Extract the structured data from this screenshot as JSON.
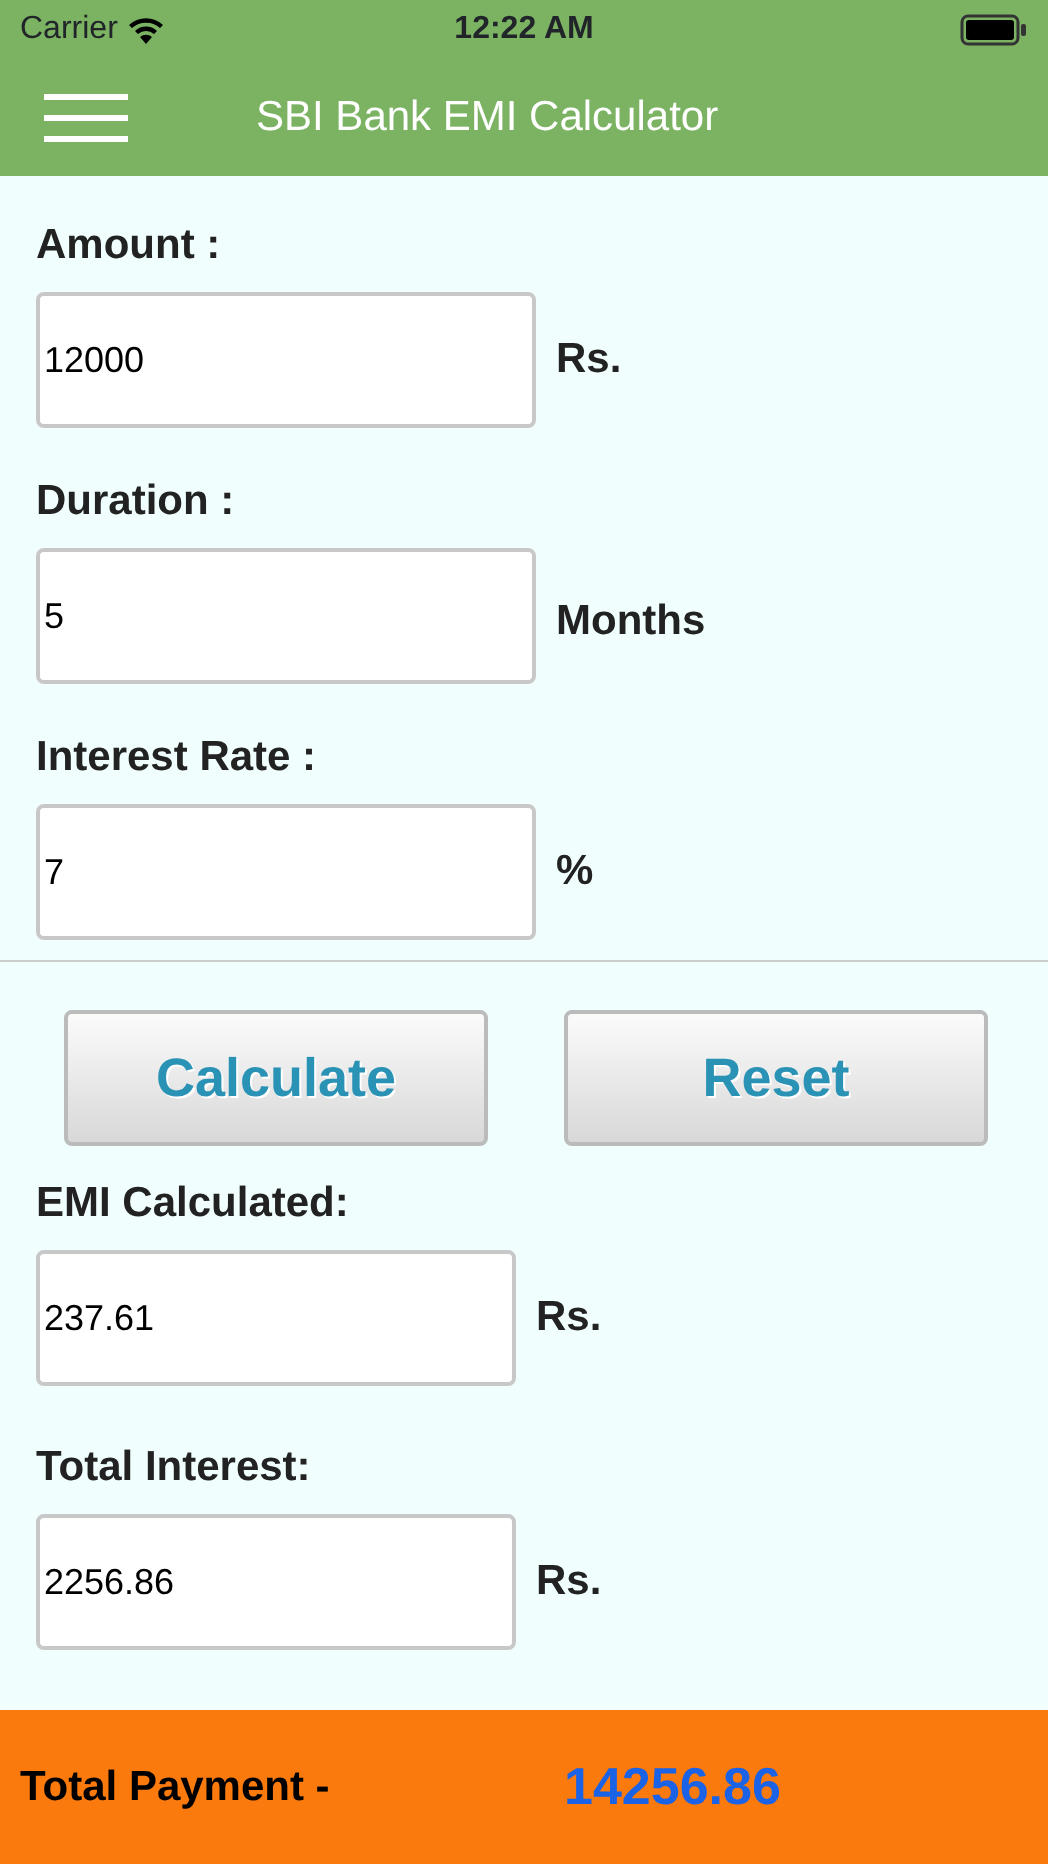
{
  "status_bar": {
    "carrier": "Carrier",
    "time": "12:22 AM"
  },
  "header": {
    "title": "SBI Bank EMI Calculator"
  },
  "inputs": [
    {
      "label": "Amount :",
      "value": "12000",
      "unit": "Rs."
    },
    {
      "label": "Duration :",
      "value": "5",
      "unit": "Months"
    },
    {
      "label": "Interest Rate :",
      "value": "7",
      "unit": "%"
    }
  ],
  "buttons": [
    {
      "label": "Calculate"
    },
    {
      "label": "Reset"
    }
  ],
  "results": [
    {
      "label": "EMI Calculated:",
      "value": "237.61",
      "unit": "Rs."
    },
    {
      "label": "Total Interest:",
      "value": "2256.86",
      "unit": "Rs."
    }
  ],
  "footer": {
    "label": "Total Payment -",
    "value": "14256.86"
  }
}
